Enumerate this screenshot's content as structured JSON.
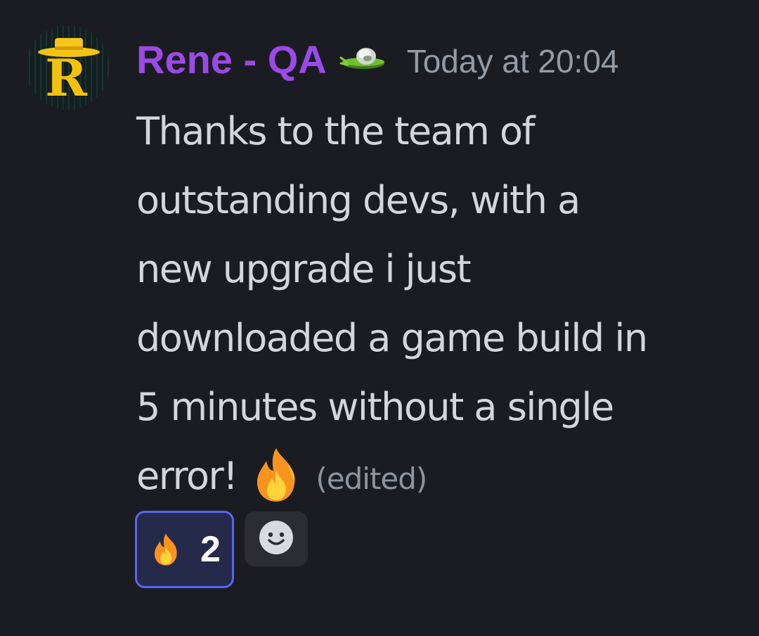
{
  "message": {
    "author": {
      "username": "Rene - QA",
      "avatar_letter": "R",
      "avatar_icon": "avatar-r-hat",
      "badge_icon": "ufo-badge-icon"
    },
    "timestamp": "Today at 20:04",
    "content_lines": [
      "Thanks to the team of",
      "outstanding devs, with a",
      "new upgrade i just",
      "downloaded a game build in",
      "5 minutes without a single",
      "error!"
    ],
    "content_emoji": "fire-emoji",
    "edited_label": "(edited)",
    "reactions": [
      {
        "emoji": "fire-emoji",
        "count": "2",
        "active": true
      }
    ],
    "add_reaction_icon": "add-reaction-smiley-icon"
  },
  "colors": {
    "background": "#1b1c21",
    "username": "#9b4ae8",
    "timestamp": "#949ba4",
    "body_text": "#d4d6da",
    "reaction_border": "#5865f2",
    "reaction_bg": "#262a4a"
  }
}
